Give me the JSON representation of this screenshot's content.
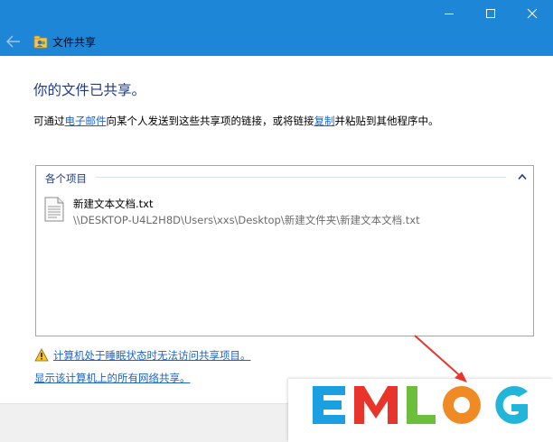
{
  "window": {
    "title": "文件共享",
    "back_icon": "back-arrow-icon",
    "app_icon": "file-share-icon",
    "controls": [
      "minimize-icon",
      "maximize-icon",
      "close-icon"
    ],
    "accent": "#1e86d6"
  },
  "main": {
    "heading": "你的文件已共享。",
    "description": {
      "part1": "可通过",
      "email_link": "电子邮件",
      "part2": "向某个人发送到这些共享项的链接，或将链接",
      "copy_link": "复制",
      "part3": "并粘贴到其他程序中。"
    }
  },
  "items": {
    "group_label": "各个项目",
    "files": [
      {
        "name": "新建文本文档.txt",
        "path": "\\\\DESKTOP-U4L2H8D\\Users\\xxs\\Desktop\\新建文件夹\\新建文本文档.txt",
        "icon": "text-document-icon"
      }
    ]
  },
  "links": {
    "sleep_warning": "计算机处于睡眠状态时无法访问共享项目。",
    "show_network_shares": "显示该计算机上的所有网络共享。"
  },
  "watermark": {
    "letters": [
      "E",
      "M",
      "L",
      "O",
      "G"
    ],
    "colors": [
      "#1a9fe0",
      "#e8342b",
      "#6cbf3a",
      "#f08a24",
      "#20b5d9"
    ]
  }
}
